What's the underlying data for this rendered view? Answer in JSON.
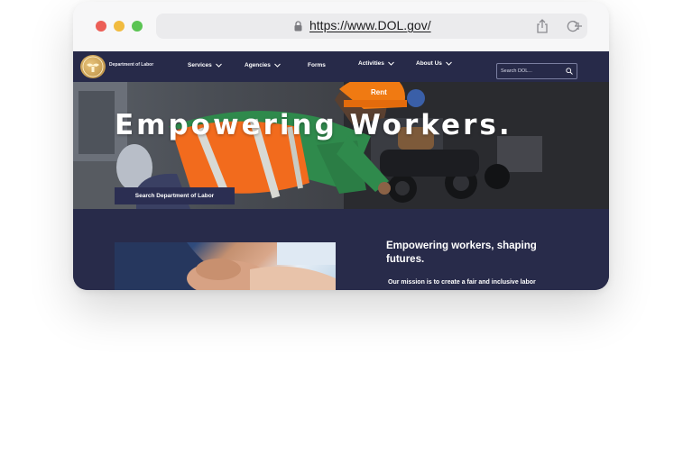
{
  "browser": {
    "url": "https://www.DOL.gov/"
  },
  "site": {
    "logo_text": "Department of Labor",
    "nav": {
      "items": [
        {
          "label": "Services",
          "has_dropdown": true
        },
        {
          "label": "Agencies",
          "has_dropdown": true
        },
        {
          "label": "Forms",
          "has_dropdown": false
        },
        {
          "label": "Activities",
          "has_dropdown": true
        },
        {
          "label": "About Us",
          "has_dropdown": true
        }
      ],
      "search_placeholder": "Search DOL..."
    },
    "hero": {
      "title": "Empowering Workers.",
      "button_label": "Search Department of Labor"
    },
    "about": {
      "heading": "Empowering workers, shaping futures.",
      "body": "Our mission is to create a fair and inclusive labor environment, ensuring that every individual has"
    }
  },
  "colors": {
    "navy": "#282b4a",
    "button": "#2b2e52",
    "vest_orange": "#f26b1d",
    "helmet_orange": "#f07a12"
  }
}
